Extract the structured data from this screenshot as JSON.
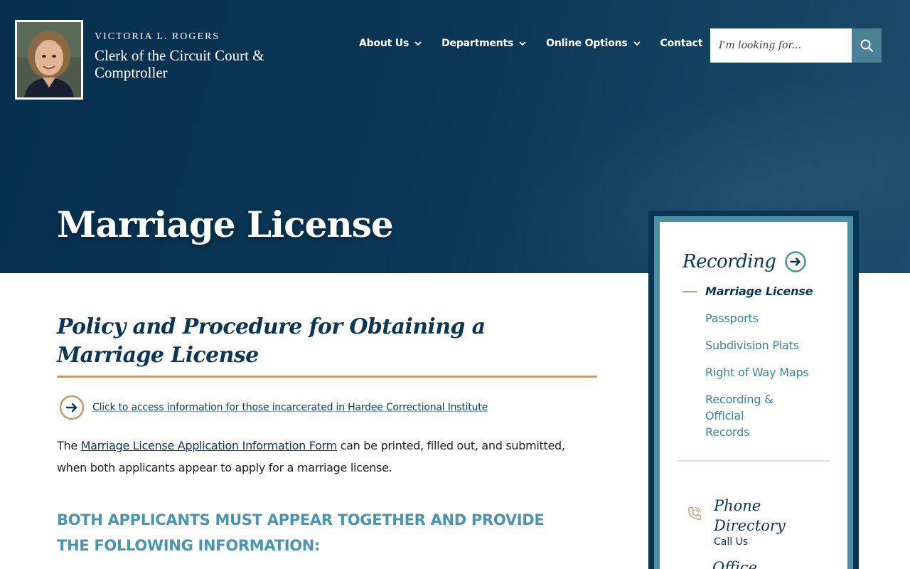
{
  "header": {
    "official_name": "Victoria L. Rogers",
    "office_title": "Clerk of the Circuit Court & Comptroller",
    "nav": [
      {
        "label": "About Us",
        "has_dropdown": true
      },
      {
        "label": "Departments",
        "has_dropdown": true
      },
      {
        "label": "Online Options",
        "has_dropdown": true
      },
      {
        "label": "Contact",
        "has_dropdown": false
      }
    ],
    "search": {
      "placeholder": "I'm looking for...",
      "value": ""
    }
  },
  "hero": {
    "title": "Marriage License"
  },
  "main": {
    "heading": "Policy and Procedure for Obtaining a Marriage License",
    "callout_link": "Click to access information for those incarcerated in Hardee Correctional Institute",
    "paragraph": {
      "before": "The ",
      "link": "Marriage License Application Information Form",
      "after": " can be printed, filled out, and submitted, when both applicants appear to apply for a marriage license."
    },
    "subheading": "Both applicants must appear together and provide the following information:"
  },
  "sidebar": {
    "heading": "Recording",
    "items": [
      {
        "label": "Marriage License",
        "active": true
      },
      {
        "label": "Passports",
        "active": false
      },
      {
        "label": "Subdivision Plats",
        "active": false
      },
      {
        "label": "Right of Way Maps",
        "active": false
      },
      {
        "label": "Recording & Official Records",
        "active": false
      }
    ],
    "contact": {
      "title": "Phone Directory",
      "subtitle": "Call Us"
    },
    "next_title": "Office"
  },
  "colors": {
    "navy": "#0c3556",
    "hero_bg": "#06304d",
    "teal": "#4b8fa6",
    "gold": "#c49a6c",
    "search_button": "#4b8196"
  },
  "icons": {
    "search": "search-icon",
    "chevron": "chevron-down-icon",
    "arrow": "arrow-right-circle-icon",
    "phone": "phone-icon"
  }
}
